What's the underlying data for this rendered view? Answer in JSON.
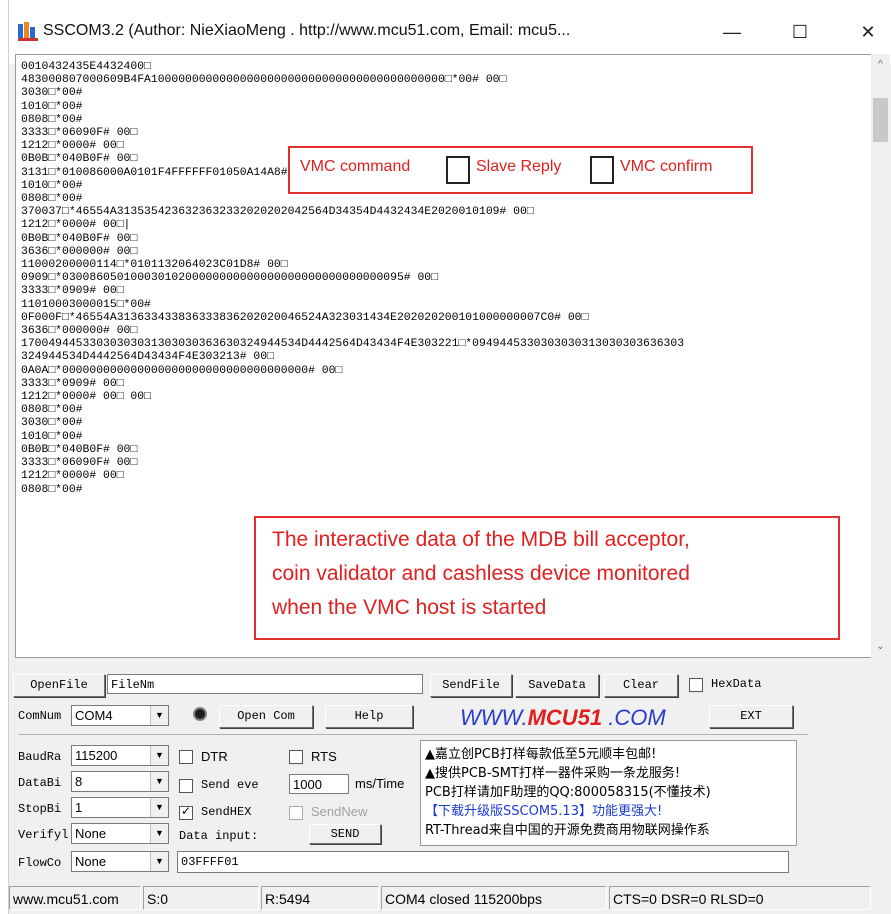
{
  "window": {
    "title": "SSCOM3.2 (Author: NieXiaoMeng . http://www.mcu51.com, Email: mcu5...",
    "minimize": "—",
    "maximize": "☐",
    "close": "✕"
  },
  "log_lines": [
    "0010432435E4432400□",
    "483000807000609B4FA1000000000000000000000000000000000000000000□*00# 00□",
    "3030□*00#",
    "1010□*00#",
    "0808□*00#",
    "3333□*06090F# 00□",
    "1212□*0000# 00□",
    "0B0B□*040B0F# 00□",
    "3131□*010086000A0101F4FFFFFF01050A14A8# 00□",
    "1010□*00#",
    "0808□*00#",
    "370037□*46554A3135354236323632332020202042564D34354D4432434E2020010109# 00□",
    "1212□*0000# 00□|",
    "0B0B□*040B0F# 00□",
    "3636□*000000# 00□",
    "11000200000114□*0101132064023C01D8# 00□",
    "0909□*03008605010003010200000000000000000000000000000095# 00□",
    "3333□*0909# 00□",
    "11010003000015□*00#",
    "0F000F□*46554A313633433836333836202020046524A323031434E202020200101000000007C0# 00□",
    "3636□*000000# 00□",
    "17004944533030303031303030363630324944534D4442564D43434F4E303221□*0949445330303030313030303636303",
    "324944534D4442564D43434F4E303213# 00□",
    "0A0A□*000000000000000000000000000000000000# 00□",
    "3333□*0909# 00□",
    "1212□*0000# 00□ 00□",
    "0808□*00#",
    "3030□*00#",
    "1010□*00#",
    "0B0B□*040B0F# 00□",
    "3333□*06090F# 00□",
    "1212□*0000# 00□",
    "0808□*00#"
  ],
  "annotations": {
    "legend": {
      "vmc_command": "VMC command",
      "slave_reply": "Slave Reply",
      "vmc_confirm": "VMC confirm"
    },
    "note_lines": [
      "The interactive data of the MDB bill acceptor,",
      "coin validator and cashless device monitored",
      "when the VMC host is started"
    ]
  },
  "toolbar": {
    "openfile": "OpenFile",
    "filename": "FileNm",
    "sendfile": "SendFile",
    "savedata": "SaveData",
    "clear": "Clear",
    "hexdata": "HexData",
    "hexdata_checked": false
  },
  "port": {
    "comnum_label": "ComNum",
    "comnum_value": "COM4",
    "open_com": "Open Com",
    "help": "Help",
    "brand_prefix": "WWW.",
    "brand_mid": "MCU51",
    "brand_suffix": " .COM",
    "ext": "EXT"
  },
  "settings": {
    "baud_label": "BaudRa",
    "baud_value": "115200",
    "databits_label": "DataBi",
    "databits_value": "8",
    "stopbits_label": "StopBi",
    "stopbits_value": "1",
    "verify_label": "Verifyl",
    "verify_value": "None",
    "flow_label": "FlowCo",
    "flow_value": "None"
  },
  "controls": {
    "dtr": "DTR",
    "rts": "RTS",
    "send_every": "Send eve",
    "interval": "1000",
    "interval_unit": "ms/Time",
    "sendhex": "SendHEX",
    "sendhex_checked": true,
    "sendnew": "SendNew",
    "data_input_label": "Data input:",
    "send": "SEND",
    "data_input_value": "03FFFF01"
  },
  "ads": [
    "▲嘉立创PCB打样每款低至5元顺丰包邮!",
    "▲搜供PCB-SMT打样一器件采购一条龙服务!",
    "PCB打样请加F助理的QQ:800058315(不懂技术)",
    "【下载升级版SSCOM5.13】功能更强大!",
    "RT-Thread来自中国的开源免费商用物联网操作系"
  ],
  "status": {
    "site": "www.mcu51.com",
    "sent": "S:0",
    "received": "R:5494",
    "port_state": "COM4 closed  115200bps",
    "lines": "CTS=0 DSR=0 RLSD=0"
  },
  "colors": {
    "annotation_red": "#e02020",
    "brand_blue": "#2a3cc8",
    "ad_blue": "#1a3ad0",
    "ad_red": "#e02020"
  }
}
